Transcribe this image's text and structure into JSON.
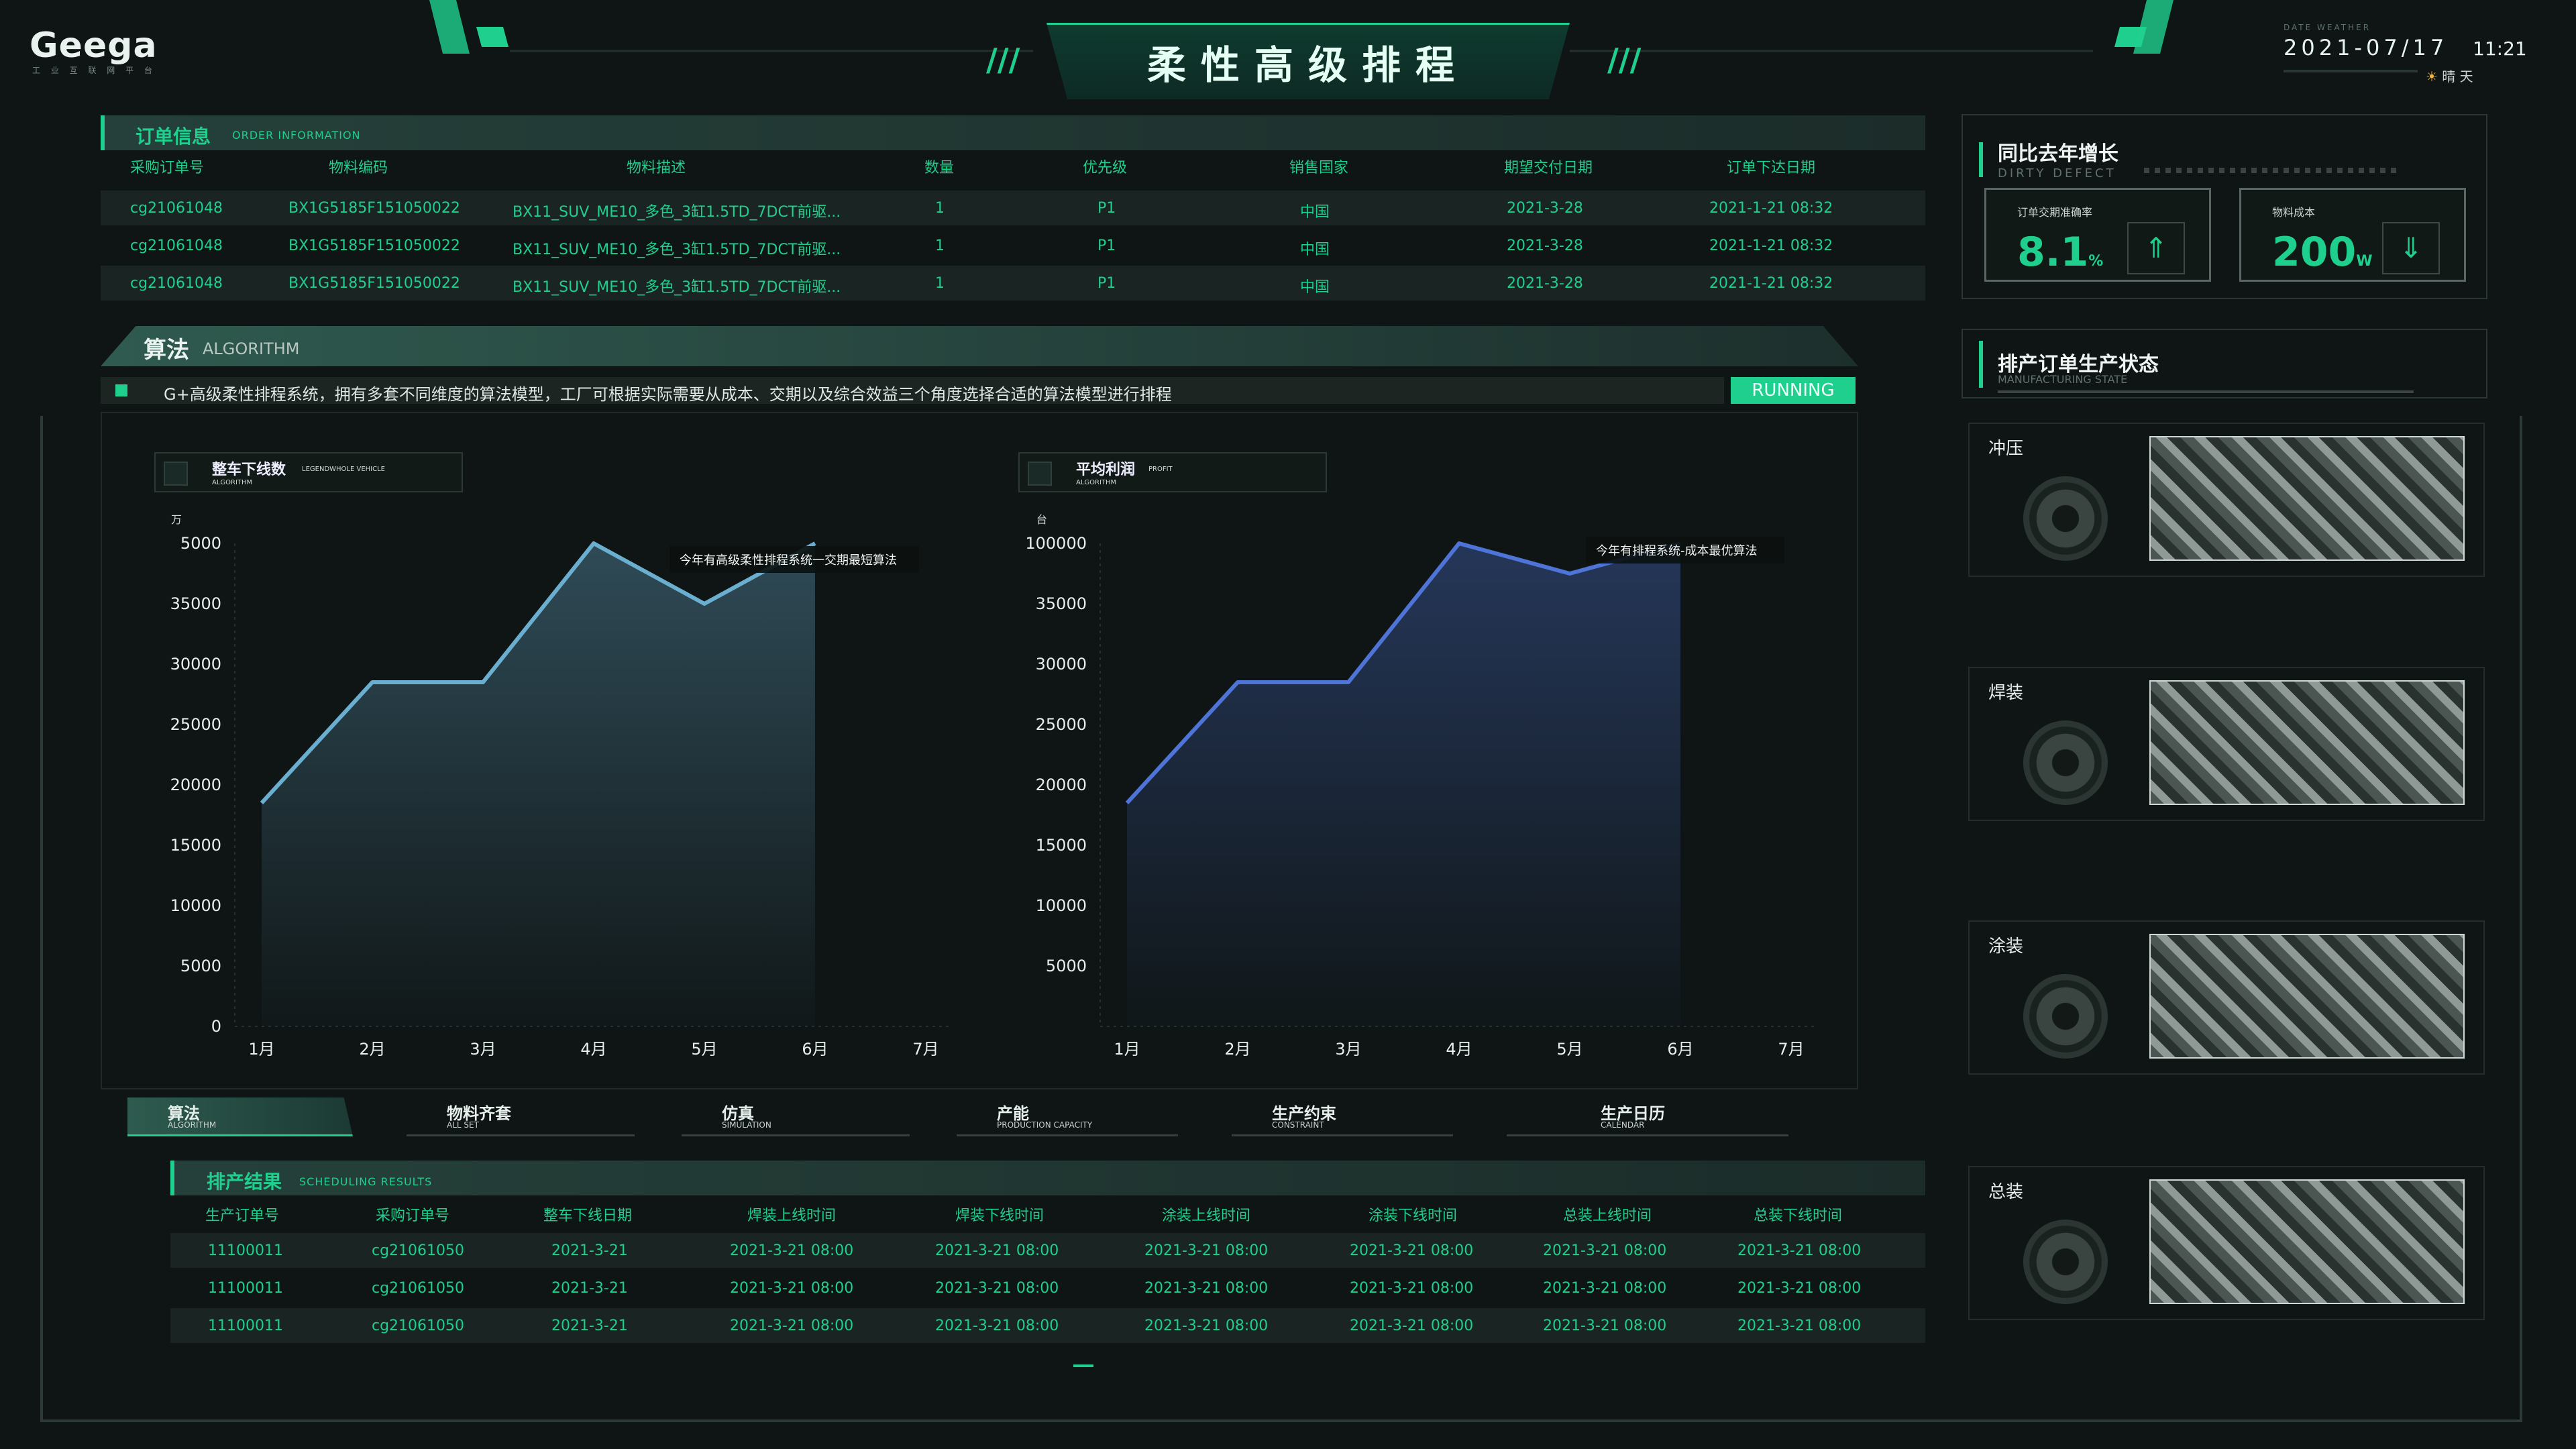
{
  "header": {
    "logo": "Geega",
    "logo_sub": "工 业 互 联 网 平 台",
    "title": "柔性高级排程",
    "date_label": "DATE WEATHER",
    "date": "2021-07/17",
    "time": "11:21",
    "weather": "晴 天"
  },
  "order_info": {
    "title_cn": "订单信息",
    "title_en": "ORDER INFORMATION",
    "columns": [
      "采购订单号",
      "物料编码",
      "物料描述",
      "数量",
      "优先级",
      "销售国家",
      "期望交付日期",
      "订单下达日期"
    ],
    "rows": [
      [
        "cg21061048",
        "BX1G5185F151050022",
        "BX11_SUV_ME10_多色_3缸1.5TD_7DCT前驱...",
        "1",
        "P1",
        "中国",
        "2021-3-28",
        "2021-1-21 08:32"
      ],
      [
        "cg21061048",
        "BX1G5185F151050022",
        "BX11_SUV_ME10_多色_3缸1.5TD_7DCT前驱...",
        "1",
        "P1",
        "中国",
        "2021-3-28",
        "2021-1-21 08:32"
      ],
      [
        "cg21061048",
        "BX1G5185F151050022",
        "BX11_SUV_ME10_多色_3缸1.5TD_7DCT前驱...",
        "1",
        "P1",
        "中国",
        "2021-3-28",
        "2021-1-21 08:32"
      ]
    ]
  },
  "algorithm": {
    "title_cn": "算法",
    "title_en": "ALGORITHM",
    "description": "G+高级柔性排程系统，拥有多套不同维度的算法模型，工厂可根据实际需要从成本、交期以及综合效益三个角度选择合适的算法模型进行排程",
    "status": "RUNNING"
  },
  "chart_data": [
    {
      "type": "area",
      "title": "整车下线数",
      "subtitle": "LEGENDWHOLE VEHICLE",
      "tag": "ALGORITHM",
      "unit": "万",
      "y_ticks": [
        "0",
        "5000",
        "10000",
        "15000",
        "20000",
        "25000",
        "30000",
        "35000",
        "5000"
      ],
      "categories": [
        "1月",
        "2月",
        "3月",
        "4月",
        "5月",
        "6月",
        "7月"
      ],
      "ylim": [
        0,
        40000
      ],
      "series": [
        {
          "name": "今年有高级柔性排程系统一交期最短算法",
          "color": "#6aaed0",
          "values": [
            18500,
            28500,
            28500,
            40000,
            35000,
            40000
          ]
        }
      ]
    },
    {
      "type": "area",
      "title": "平均利润",
      "subtitle": "PROFIT",
      "tag": "ALGORITHM",
      "unit": "台",
      "y_ticks": [
        "5000",
        "10000",
        "15000",
        "20000",
        "25000",
        "30000",
        "35000",
        "100000"
      ],
      "categories": [
        "1月",
        "2月",
        "3月",
        "4月",
        "5月",
        "6月",
        "7月"
      ],
      "ylim": [
        0,
        40000
      ],
      "series": [
        {
          "name": "今年有排程系统-成本最优算法",
          "color": "#4d74d6",
          "values": [
            18500,
            28500,
            28500,
            40000,
            37500,
            40000
          ]
        }
      ]
    }
  ],
  "tabs": [
    {
      "cn": "算法",
      "en": "ALGORITHM"
    },
    {
      "cn": "物料齐套",
      "en": "ALL SET"
    },
    {
      "cn": "仿真",
      "en": "SIMULATION"
    },
    {
      "cn": "产能",
      "en": "PRODUCTION CAPACITY"
    },
    {
      "cn": "生产约束",
      "en": "CONSTRAINT"
    },
    {
      "cn": "生产日历",
      "en": "CALENDAR"
    }
  ],
  "schedule": {
    "title_cn": "排产结果",
    "title_en": "SCHEDULING RESULTS",
    "columns": [
      "生产订单号",
      "采购订单号",
      "整车下线日期",
      "焊装上线时间",
      "焊装下线时间",
      "涂装上线时间",
      "涂装下线时间",
      "总装上线时间",
      "总装下线时间"
    ],
    "rows": [
      [
        "11100011",
        "cg21061050",
        "2021-3-21",
        "2021-3-21 08:00",
        "2021-3-21 08:00",
        "2021-3-21 08:00",
        "2021-3-21 08:00",
        "2021-3-21 08:00",
        "2021-3-21 08:00"
      ],
      [
        "11100011",
        "cg21061050",
        "2021-3-21",
        "2021-3-21 08:00",
        "2021-3-21 08:00",
        "2021-3-21 08:00",
        "2021-3-21 08:00",
        "2021-3-21 08:00",
        "2021-3-21 08:00"
      ],
      [
        "11100011",
        "cg21061050",
        "2021-3-21",
        "2021-3-21 08:00",
        "2021-3-21 08:00",
        "2021-3-21 08:00",
        "2021-3-21 08:00",
        "2021-3-21 08:00",
        "2021-3-21 08:00"
      ]
    ]
  },
  "growth": {
    "title_cn": "同比去年增长",
    "title_en": "DIRTY DEFECT",
    "kpis": [
      {
        "label": "订单交期准确率",
        "value": "8.1",
        "unit": "%",
        "arrow": "up-arrow-icon"
      },
      {
        "label": "物料成本",
        "value": "200",
        "unit": "W",
        "arrow": "down-arrow-icon"
      }
    ]
  },
  "status": {
    "title_cn": "排产订单生产状态",
    "title_en": "MANUFACTURING STATE",
    "stages": [
      "冲压",
      "焊装",
      "涂装",
      "总装"
    ]
  },
  "colors": {
    "accent": "#1fcf8e",
    "background": "#0f1515"
  }
}
